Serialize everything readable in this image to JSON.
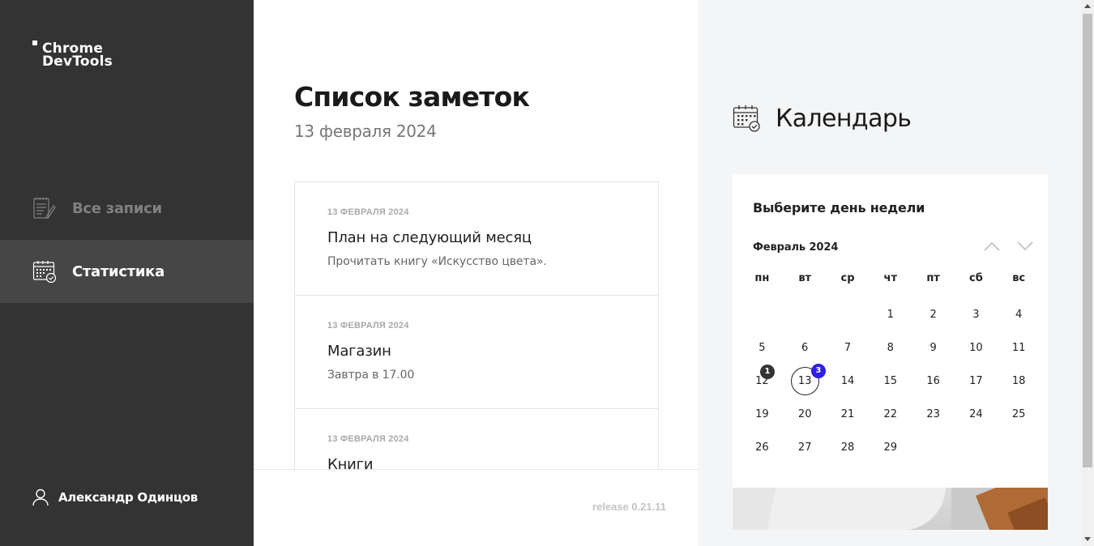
{
  "brand": {
    "line1": "Chrome",
    "line2": "DevTools"
  },
  "sidebar": {
    "items": [
      {
        "label": "Все записи",
        "icon": "notes-icon",
        "active": false
      },
      {
        "label": "Статистика",
        "icon": "calendar-icon",
        "active": true
      }
    ],
    "user": {
      "name": "Александр Одинцов",
      "icon": "user-icon"
    }
  },
  "main": {
    "title": "Список заметок",
    "date": "13 февраля 2024",
    "notes": [
      {
        "date": "13 ФЕВРАЛЯ 2024",
        "title": "План на следующий месяц",
        "body": "Прочитать книгу «Искусство цвета»."
      },
      {
        "date": "13 ФЕВРАЛЯ 2024",
        "title": "Магазин",
        "body": "Завтра в 17.00"
      },
      {
        "date": "13 ФЕВРАЛЯ 2024",
        "title": "Книги",
        "body": ""
      }
    ],
    "release": "release 0.21.11"
  },
  "calendar": {
    "title": "Календарь",
    "prompt": "Выберите день недели",
    "month": "Февраль 2024",
    "weekdays": [
      "пн",
      "вт",
      "ср",
      "чт",
      "пт",
      "сб",
      "вс"
    ],
    "weeks": [
      [
        "",
        "",
        "",
        "1",
        "2",
        "3",
        "4"
      ],
      [
        "5",
        "6",
        "7",
        "8",
        "9",
        "10",
        "11"
      ],
      [
        "12",
        "13",
        "14",
        "15",
        "16",
        "17",
        "18"
      ],
      [
        "19",
        "20",
        "21",
        "22",
        "23",
        "24",
        "25"
      ],
      [
        "26",
        "27",
        "28",
        "29",
        "",
        "",
        ""
      ]
    ],
    "selected": "13",
    "badges": [
      {
        "day": "12",
        "count": "1",
        "color": "#333333"
      },
      {
        "day": "13",
        "count": "3",
        "color": "#2d1fe6"
      }
    ]
  },
  "colors": {
    "sidebar": "#333333",
    "sidebar_active": "#464646",
    "accent": "#2d1fe6",
    "panel": "#f4f5f7"
  }
}
